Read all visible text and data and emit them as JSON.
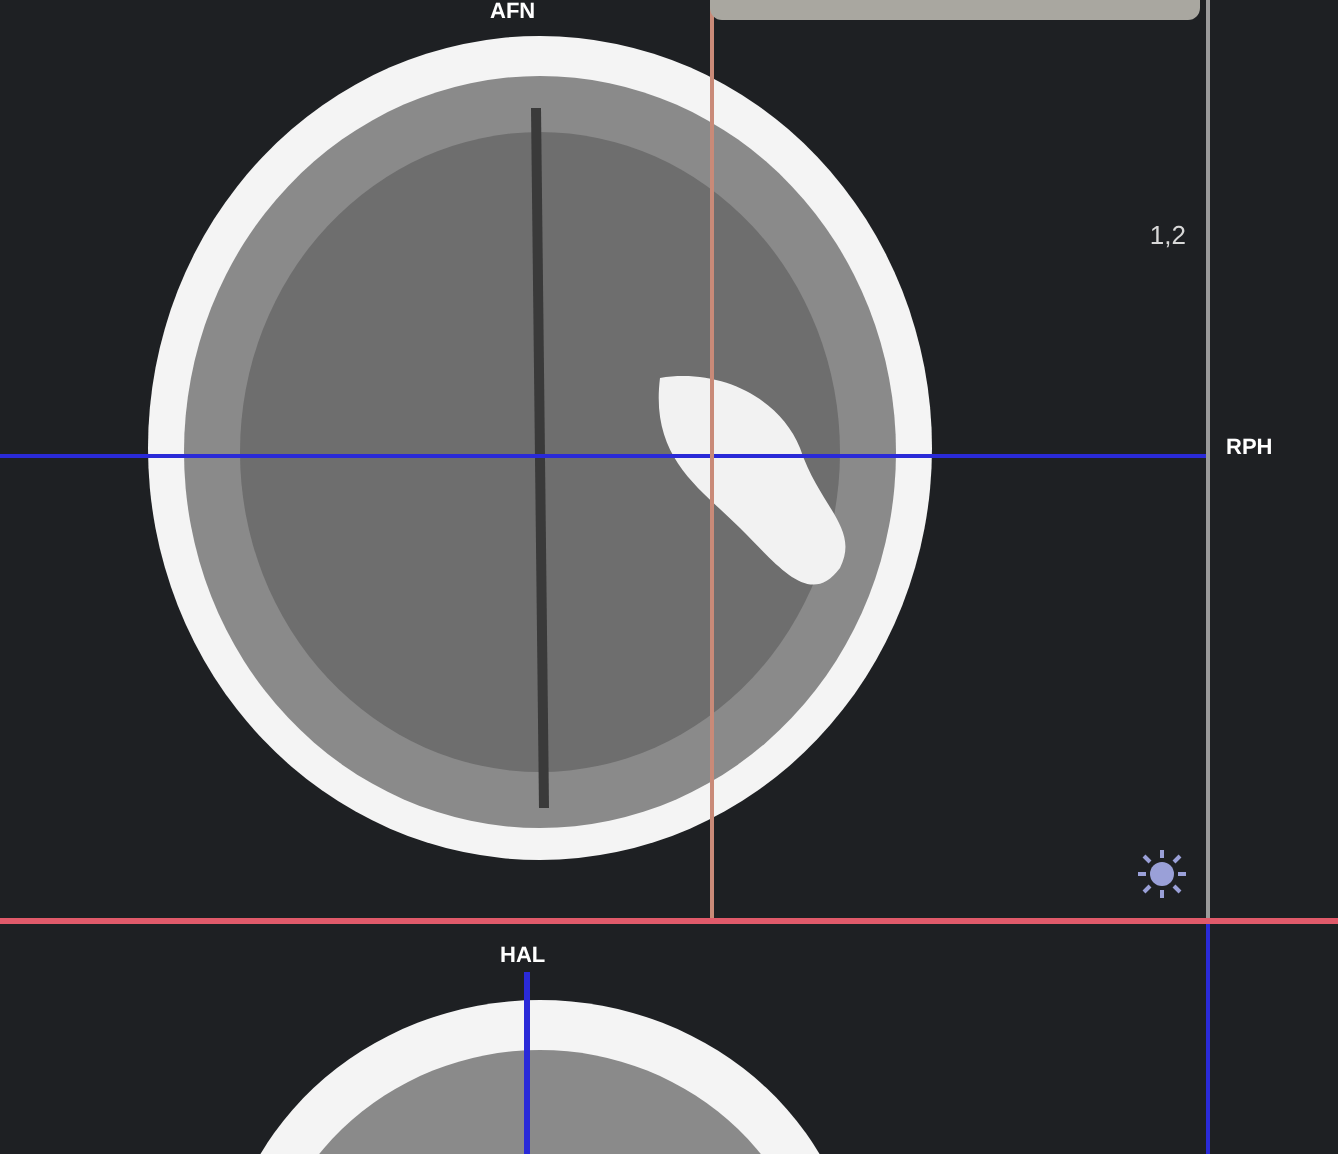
{
  "axial_view": {
    "top_label": "AFN",
    "right_label": "RPH",
    "zoom_value": "1,2"
  },
  "coronal_view": {
    "top_label": "HAL"
  }
}
